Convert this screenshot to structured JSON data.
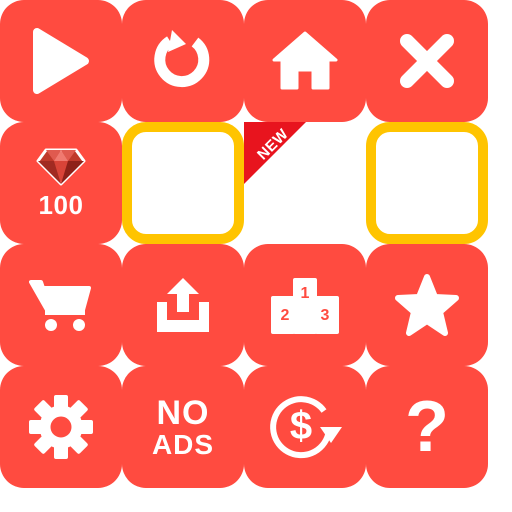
{
  "colors": {
    "tile": "#ff4b40",
    "frame": "#ffc400",
    "ribbon": "#e8141e",
    "icon": "#ffffff"
  },
  "icons": [
    "play-icon",
    "restart-icon",
    "home-icon",
    "close-icon",
    "gem-icon",
    "cart-icon",
    "share-icon",
    "podium-icon",
    "star-icon",
    "gear-icon",
    "currency-exchange-icon"
  ],
  "gems": {
    "count": "100"
  },
  "badge": {
    "label": "NEW"
  },
  "podium": {
    "first": "1",
    "second": "2",
    "third": "3"
  },
  "no_ads": {
    "line1": "NO",
    "line2": "ADS"
  },
  "currency": {
    "symbol": "$"
  },
  "help": {
    "label": "?"
  }
}
